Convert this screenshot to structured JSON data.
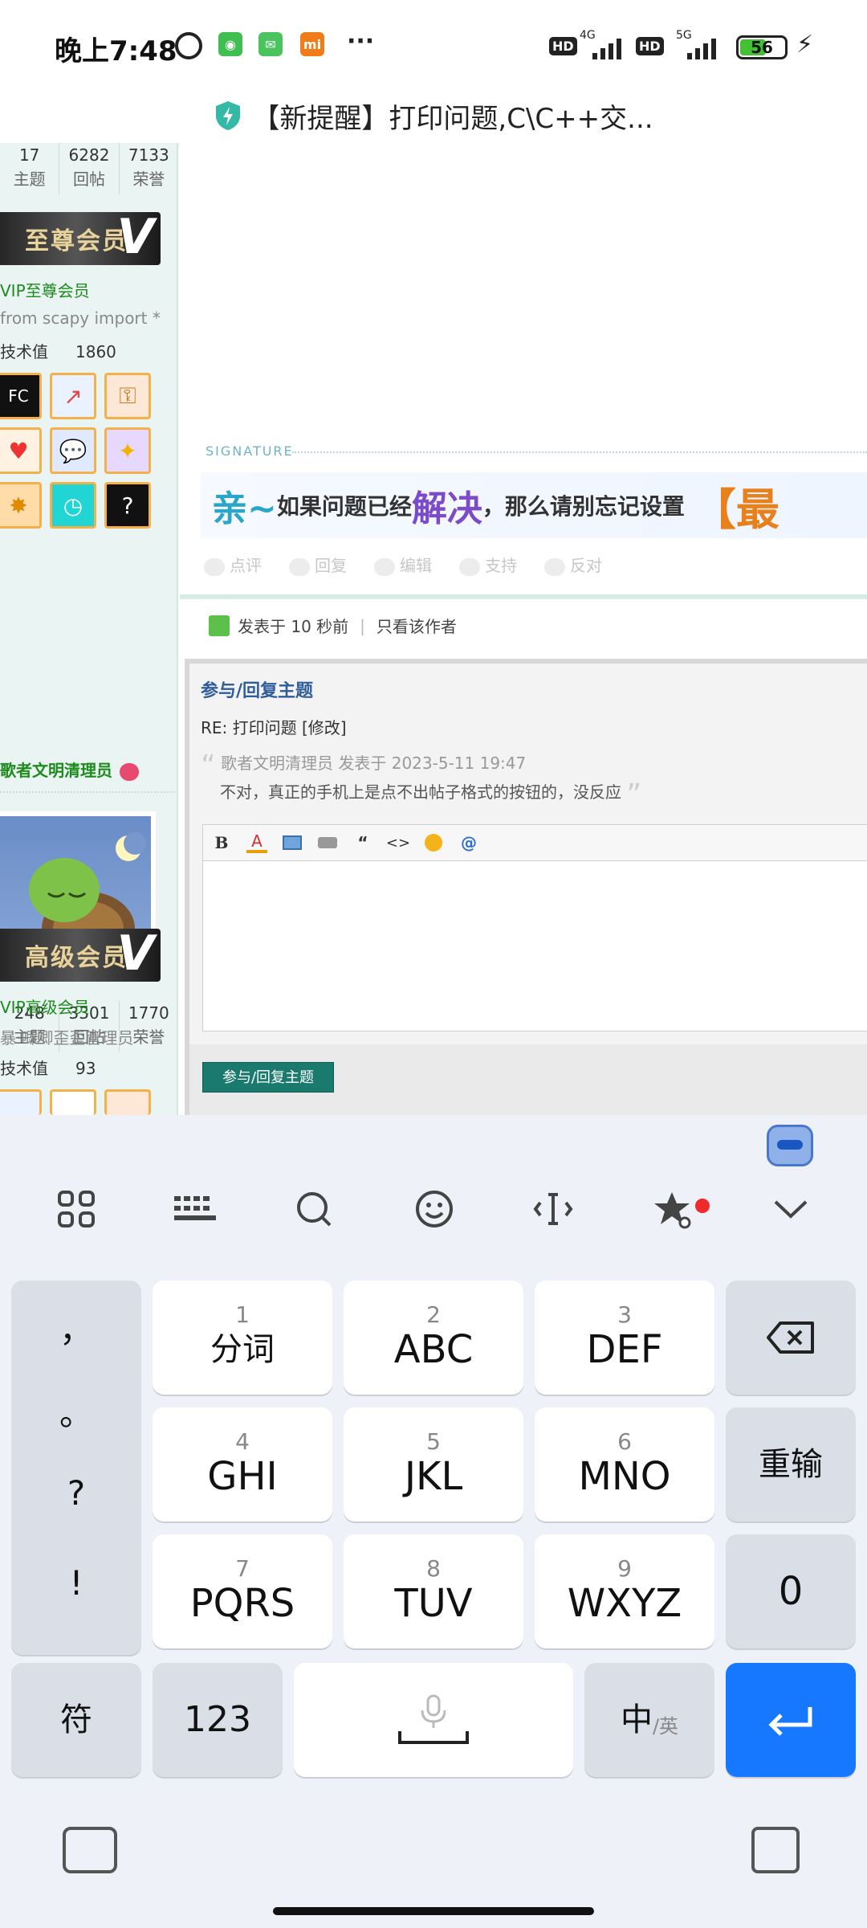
{
  "status_bar": {
    "time": "晚上7:48",
    "net_left": "4G",
    "net_right": "5G",
    "hd": "HD",
    "battery": "56",
    "more": "···"
  },
  "title_bar": {
    "title": "【新提醒】打印问题,C\\C++交..."
  },
  "sidebar": {
    "user1": {
      "stats": [
        {
          "value": "17",
          "label": "主题"
        },
        {
          "value": "6282",
          "label": "回帖"
        },
        {
          "value": "7133",
          "label": "荣誉"
        }
      ],
      "badge": "至尊会员",
      "rank": "VIP至尊会员",
      "signature": "from scapy import *",
      "tech_label": "技术值",
      "tech_value": "1860"
    },
    "user2": {
      "name": "歌者文明清理员",
      "stats": [
        {
          "value": "248",
          "label": "主题"
        },
        {
          "value": "3301",
          "label": "回帖"
        },
        {
          "value": "1770",
          "label": "荣誉"
        }
      ],
      "badge": "高级会员",
      "rank": "VIP高级会员",
      "title": "暴·唧唧歪歪管理员",
      "tech_label": "技术值",
      "tech_value": "93"
    }
  },
  "post": {
    "signature_label": "SIGNATURE",
    "signature_banner": {
      "p1": "亲~",
      "p2": "如果问题已经",
      "p3": "解决",
      "p4": "，那么请别忘记设置",
      "p5": "【最"
    },
    "actions": [
      "点评",
      "回复",
      "编辑",
      "支持",
      "反对"
    ],
    "posted": "发表于 10 秒前",
    "only_author": "只看该作者"
  },
  "reply": {
    "heading": "参与/回复主题",
    "subject": "RE: 打印问题 [修改]",
    "quote_header": "歌者文明清理员 发表于 2023-5-11 19:47",
    "quote_body": "不对，真正的手机上是点不出帖子格式的按钮的，没反应",
    "toolbar": [
      "B",
      "A",
      "img",
      "attach",
      "“",
      "<>",
      "emoji",
      "@"
    ],
    "submit": "参与/回复主题"
  },
  "keyboard": {
    "punct": [
      "，",
      "。",
      "?",
      "!"
    ],
    "keys": [
      {
        "num": "1",
        "label": "分词"
      },
      {
        "num": "2",
        "label": "ABC"
      },
      {
        "num": "3",
        "label": "DEF"
      },
      {
        "num": "4",
        "label": "GHI"
      },
      {
        "num": "5",
        "label": "JKL"
      },
      {
        "num": "6",
        "label": "MNO"
      },
      {
        "num": "7",
        "label": "PQRS"
      },
      {
        "num": "8",
        "label": "TUV"
      },
      {
        "num": "9",
        "label": "WXYZ"
      }
    ],
    "reinput": "重输",
    "zero": "0",
    "symbols": "符",
    "numbers": "123",
    "lang_main": "中",
    "lang_alt": "/英"
  },
  "colors": {
    "accent_blue": "#1677ff",
    "sidebar_bg": "#eaf5f3",
    "rank_green": "#1c8a1c",
    "submit_teal": "#1a7a6e",
    "heading_blue": "#2f5d9c"
  }
}
